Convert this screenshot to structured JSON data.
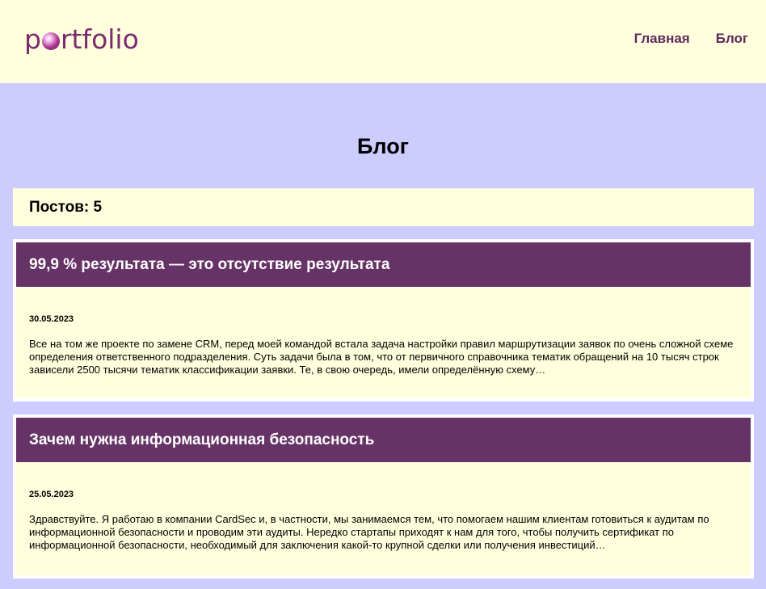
{
  "logo": {
    "text_before": "p",
    "text_after": "rtfolio"
  },
  "nav": {
    "home": "Главная",
    "blog": "Блог"
  },
  "page": {
    "title": "Блог",
    "post_count": "Постов: 5"
  },
  "posts": [
    {
      "title": "99,9 % результата — это отсутствие результата",
      "date": "30.05.2023",
      "excerpt": "Все на том же проекте по замене CRM, перед моей командой встала задача настройки правил маршрутизации заявок по очень сложной схеме определения ответственного подразделения. Суть задачи была в том, что от первичного справочника тематик обращений на 10 тысяч строк зависели 2500 тысячи тематик классификации заявки. Те, в свою очередь, имели определённую схему…"
    },
    {
      "title": "Зачем нужна информационная безопасность",
      "date": "25.05.2023",
      "excerpt": "Здравствуйте. Я работаю в компании CardSec и, в частности, мы занимаемся тем, что помогаем нашим клиентам готовиться к аудитам по информационной безопасности и проводим эти аудиты. Нередко стартапы приходят к нам для того, чтобы получить сертификат по информационной безопасности, необходимый для заключения какой-то крупной сделки или получения инвестиций…"
    }
  ],
  "colors": {
    "page_bg": "#ccccff",
    "header_bg": "#ffffdd",
    "card_bg": "#ffffdd",
    "post_title_bg": "#663366",
    "nav_text": "#5e2a5e",
    "logo_text": "#7a2a6e"
  }
}
